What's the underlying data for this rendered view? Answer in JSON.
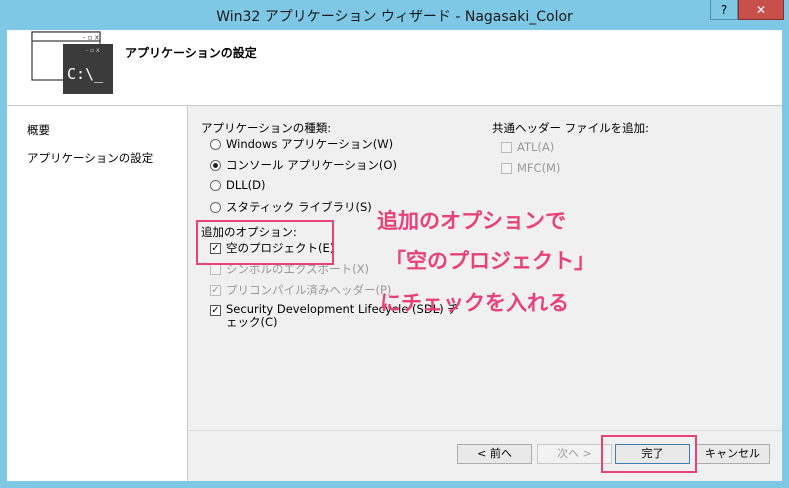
{
  "window": {
    "title": "Win32 アプリケーション ウィザード - Nagasaki_Color",
    "help_label": "?",
    "close_label": "✕"
  },
  "header": {
    "title": "アプリケーションの設定",
    "icon_text": "C:\\_"
  },
  "nav": {
    "items": [
      {
        "label": "概要"
      },
      {
        "label": "アプリケーションの設定"
      }
    ]
  },
  "app_type": {
    "label": "アプリケーションの種類:",
    "options": [
      {
        "label": "Windows アプリケーション(W)",
        "checked": false
      },
      {
        "label": "コンソール アプリケーション(O)",
        "checked": true
      },
      {
        "label": "DLL(D)",
        "checked": false
      },
      {
        "label": "スタティック ライブラリ(S)",
        "checked": false
      }
    ]
  },
  "additional": {
    "label": "追加のオプション:",
    "options": [
      {
        "label": "空のプロジェクト(E)",
        "checked": true,
        "enabled": true
      },
      {
        "label": "シンボルのエクスポート(X)",
        "checked": false,
        "enabled": false
      },
      {
        "label": "プリコンパイル済みヘッダー(P)",
        "checked": true,
        "enabled": false
      },
      {
        "label": "Security Development Lifecycle (SDL) チェック(C)",
        "checked": true,
        "enabled": true
      }
    ]
  },
  "common_headers": {
    "label": "共通ヘッダー ファイルを追加:",
    "options": [
      {
        "label": "ATL(A)",
        "checked": false,
        "enabled": false
      },
      {
        "label": "MFC(M)",
        "checked": false,
        "enabled": false
      }
    ]
  },
  "annotation": {
    "line1": "追加のオプションで",
    "line2": "「空のプロジェクト」",
    "line3": "にチェックを入れる",
    "color": "#e8407a"
  },
  "buttons": {
    "back": "< 前へ",
    "next": "次へ >",
    "finish": "完了",
    "cancel": "キャンセル"
  }
}
